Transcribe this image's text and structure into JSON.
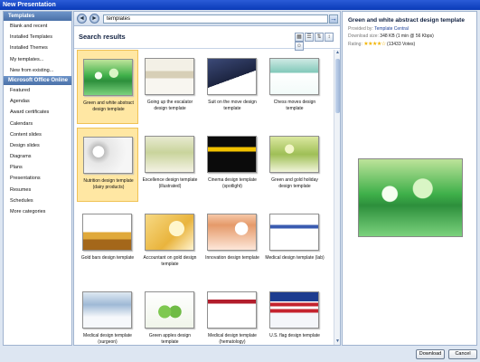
{
  "window": {
    "title": "New Presentation"
  },
  "sidebar": {
    "items": [
      {
        "label": "Templates",
        "kind": "header"
      },
      {
        "label": "Blank and recent",
        "kind": "item"
      },
      {
        "label": "Installed Templates",
        "kind": "item"
      },
      {
        "label": "Installed Themes",
        "kind": "item"
      },
      {
        "label": "My templates...",
        "kind": "item"
      },
      {
        "label": "New from existing...",
        "kind": "item"
      },
      {
        "label": "Microsoft Office Online",
        "kind": "header"
      },
      {
        "label": "Featured",
        "kind": "item"
      },
      {
        "label": "Agendas",
        "kind": "item"
      },
      {
        "label": "Award certificates",
        "kind": "item"
      },
      {
        "label": "Calendars",
        "kind": "item"
      },
      {
        "label": "Content slides",
        "kind": "item"
      },
      {
        "label": "Design slides",
        "kind": "item"
      },
      {
        "label": "Diagrams",
        "kind": "item"
      },
      {
        "label": "Plans",
        "kind": "item"
      },
      {
        "label": "Presentations",
        "kind": "item"
      },
      {
        "label": "Resumes",
        "kind": "item"
      },
      {
        "label": "Schedules",
        "kind": "item"
      },
      {
        "label": "More categories",
        "kind": "item"
      }
    ]
  },
  "navbar": {
    "back_glyph": "◄",
    "forward_glyph": "►",
    "search_value": "templates",
    "go_glyph": "→"
  },
  "results": {
    "heading": "Search results",
    "sort_icons": [
      "thumbnail-view-icon",
      "list-view-icon",
      "sort-ascending-icon",
      "sort-descending-icon",
      "user-rating-icon"
    ],
    "sort_glyphs": [
      "▦",
      "☰",
      "⇅",
      "↕",
      "☺"
    ],
    "tiles": [
      {
        "caption": "Green and white abstract design template",
        "thumb": "t-green",
        "selected": true
      },
      {
        "caption": "Going up the escalator design template",
        "thumb": "t-esc",
        "selected": false
      },
      {
        "caption": "Suit on the move design template",
        "thumb": "t-suit",
        "selected": false
      },
      {
        "caption": "Chess moves design template",
        "thumb": "t-chess",
        "selected": false
      },
      {
        "caption": "Nutrition design template (dairy products)",
        "thumb": "t-nutri",
        "selected": true
      },
      {
        "caption": "Excellence design template (illustrated)",
        "thumb": "t-excel",
        "selected": false
      },
      {
        "caption": "Cinema design template (spotlight)",
        "thumb": "t-cinema",
        "selected": false
      },
      {
        "caption": "Green and gold holiday design template",
        "thumb": "t-greengold",
        "selected": false
      },
      {
        "caption": "Gold bars design template",
        "thumb": "t-goldbars",
        "selected": false
      },
      {
        "caption": "Accountant on gold design template",
        "thumb": "t-account",
        "selected": false
      },
      {
        "caption": "Innovation design template",
        "thumb": "t-innov",
        "selected": false
      },
      {
        "caption": "Medical design template (lab)",
        "thumb": "t-medlab",
        "selected": false
      },
      {
        "caption": "Medical design template (surgeon)",
        "thumb": "t-surgeon",
        "selected": false
      },
      {
        "caption": "Green apples design template",
        "thumb": "t-apples",
        "selected": false
      },
      {
        "caption": "Medical design template (hematology)",
        "thumb": "t-hema",
        "selected": false
      },
      {
        "caption": "U.S. flag design template",
        "thumb": "t-flag",
        "selected": false
      }
    ]
  },
  "detail": {
    "title": "Green and white abstract design template",
    "provided_by_label": "Provided by:",
    "provided_by_value": "Template Central",
    "download_size_label": "Download size:",
    "download_size_value": "348 KB (1 min @ 56 Kbps)",
    "rating_label": "Rating:",
    "rating_stars": "★★★★☆",
    "rating_votes": "(13433 Votes)"
  },
  "footer": {
    "download_label": "Download",
    "cancel_label": "Cancel"
  }
}
